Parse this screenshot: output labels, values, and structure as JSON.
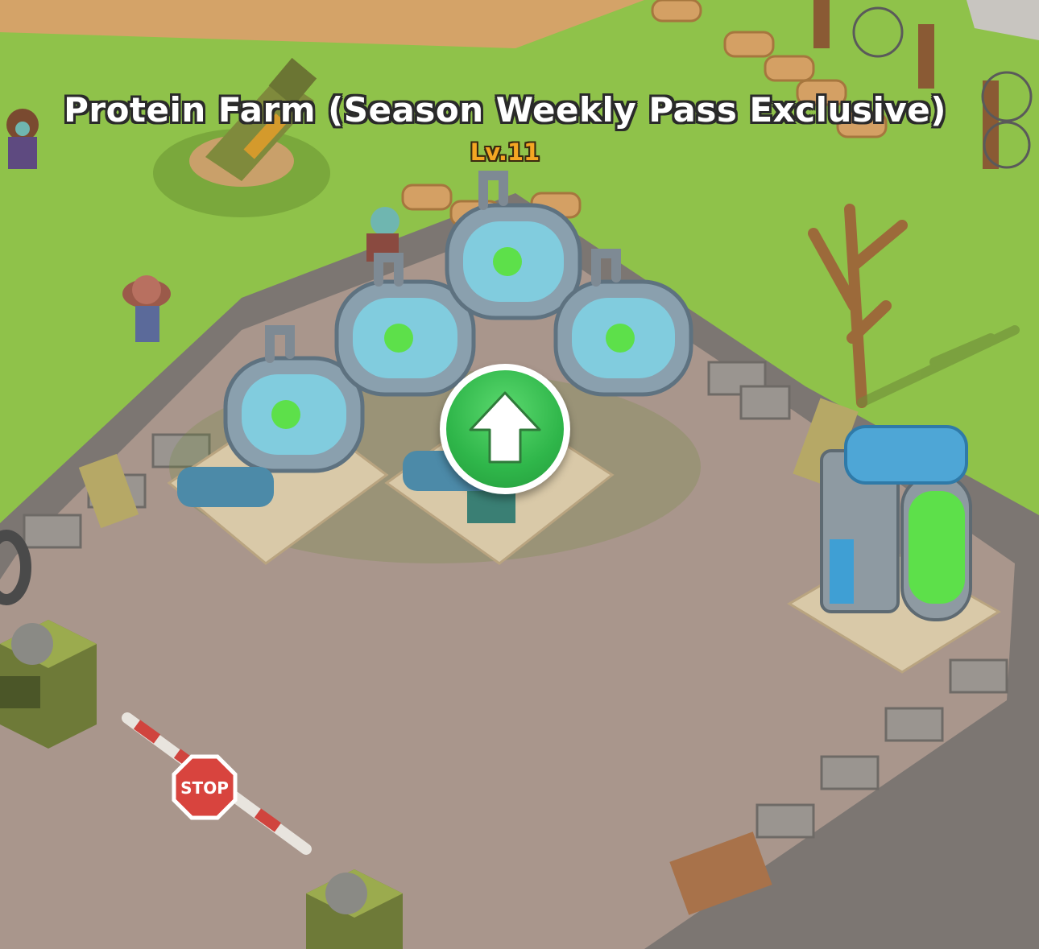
{
  "building": {
    "name": "Protein Farm (Season Weekly Pass Exclusive)",
    "level": "Lv.11"
  },
  "sign": {
    "stop_text": "STOP"
  },
  "actions": {
    "upgrade_icon": "arrow-up-icon"
  },
  "colors": {
    "grass": "#8fc24a",
    "plaza": "#a9968c",
    "upgrade_green": "#2fb64a",
    "level_orange": "#f5a623",
    "tank_glow": "#5de04a"
  }
}
